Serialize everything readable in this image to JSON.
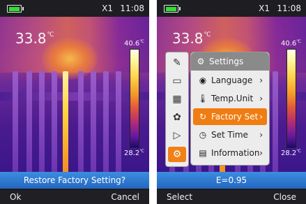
{
  "left_screen": {
    "status": {
      "zoom": "X1",
      "time": "11:08"
    },
    "center_temp": "33.8",
    "temp_unit": "℃",
    "scale_max": "40.6",
    "scale_min": "28.2",
    "prompt": "Restore Factory Setting?",
    "softkeys": {
      "left": "Ok",
      "right": "Cancel"
    }
  },
  "right_screen": {
    "status": {
      "zoom": "X1",
      "time": "11:08"
    },
    "center_temp": "33.8",
    "temp_unit": "℃",
    "scale_max": "40.6",
    "scale_min": "28.2",
    "iconbar": [
      {
        "icon": "pencil-ruler-icon",
        "glyph": "✎"
      },
      {
        "icon": "measure-icon",
        "glyph": "▭"
      },
      {
        "icon": "image-gallery-icon",
        "glyph": "▦"
      },
      {
        "icon": "palette-icon",
        "glyph": "✿"
      },
      {
        "icon": "camera-video-icon",
        "glyph": "▷"
      },
      {
        "icon": "settings-gear-icon",
        "glyph": "⚙",
        "active": true
      }
    ],
    "menu": {
      "title": "Settings",
      "items": [
        {
          "label": "Language",
          "icon": "speech-bubble-icon",
          "glyph": "◉",
          "arrow": "›"
        },
        {
          "label": "Temp.Unit",
          "icon": "thermometer-icon",
          "glyph": "🌡",
          "arrow": "›"
        },
        {
          "label": "Factory Set",
          "icon": "reset-icon",
          "glyph": "↻",
          "arrow": "›",
          "selected": true
        },
        {
          "label": "Set Time",
          "icon": "clock-icon",
          "glyph": "◷",
          "arrow": "›"
        },
        {
          "label": "Information",
          "icon": "document-icon",
          "glyph": "▤",
          "arrow": "›"
        }
      ]
    },
    "emissivity": "E=0.95",
    "softkeys": {
      "left": "Select",
      "right": "Close"
    }
  },
  "colors": {
    "accent": "#f07d12",
    "bar_blue": "#2f7ad0",
    "battery": "#33e033"
  }
}
